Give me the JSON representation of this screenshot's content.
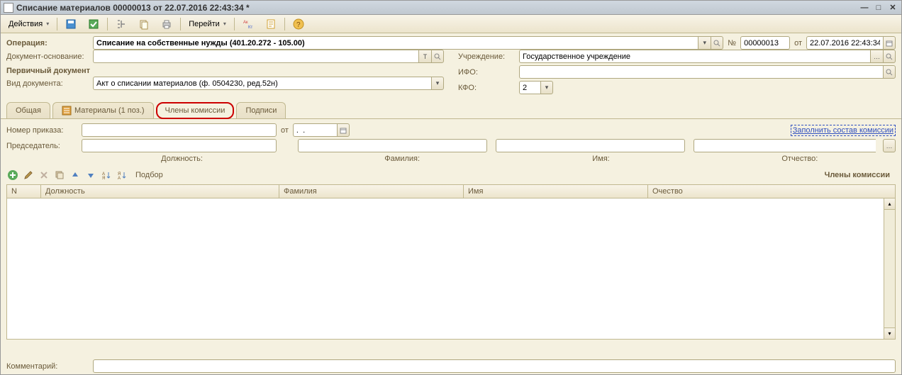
{
  "window": {
    "title": "Списание материалов 00000013 от 22.07.2016 22:43:34 *"
  },
  "toolbar": {
    "actions": "Действия",
    "goto": "Перейти"
  },
  "header": {
    "operation_label": "Операция:",
    "operation_value": "Списание на собственные нужды (401.20.272 - 105.00)",
    "number_label": "№",
    "number_value": "00000013",
    "date_label": "от",
    "date_value": "22.07.2016 22:43:34"
  },
  "left": {
    "doc_basis_label": "Документ-основание:",
    "doc_basis_value": "",
    "primary_doc_label": "Первичный документ",
    "doc_type_label": "Вид документа:",
    "doc_type_value": "Акт о списании материалов (ф. 0504230, ред.52н)"
  },
  "right": {
    "institution_label": "Учреждение:",
    "institution_value": "Государственное учреждение",
    "ifo_label": "ИФО:",
    "ifo_value": "",
    "kfo_label": "КФО:",
    "kfo_value": "2"
  },
  "tabs": {
    "general": "Общая",
    "materials": "Материалы (1 поз.)",
    "commission": "Члены комиссии",
    "signatures": "Подписи"
  },
  "commission": {
    "order_num_label": "Номер приказа:",
    "order_num_value": "",
    "order_date_label": "от",
    "order_date_value": ".  .",
    "fill_link": "Заполнить состав комиссии",
    "chairman_label": "Председатель:",
    "position_label": "Должность:",
    "surname_label": "Фамилия:",
    "name_label": "Имя:",
    "patronymic_label": "Отчество:",
    "selection": "Подбор",
    "grid_title": "Члены комиссии",
    "cols": {
      "n": "N",
      "position": "Должность",
      "surname": "Фамилия",
      "name": "Имя",
      "patronymic": "Очество"
    }
  },
  "footer": {
    "comment_label": "Комментарий:",
    "comment_value": ""
  }
}
